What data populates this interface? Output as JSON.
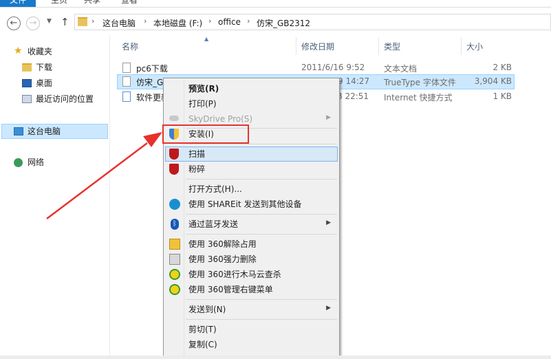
{
  "ribbon": {
    "tabs": [
      "文件",
      "主页",
      "共享",
      "查看"
    ]
  },
  "addressbar": {
    "back_icon": "back-arrow-icon",
    "forward_icon": "forward-arrow-icon",
    "up_icon": "up-arrow-icon",
    "breadcrumb": [
      "这台电脑",
      "本地磁盘 (F:)",
      "office",
      "仿宋_GB2312"
    ]
  },
  "navpane": {
    "items": [
      {
        "label": "收藏夹",
        "icon": "star-icon"
      },
      {
        "label": "下载",
        "icon": "download-folder-icon"
      },
      {
        "label": "桌面",
        "icon": "desktop-icon"
      },
      {
        "label": "最近访问的位置",
        "icon": "recent-places-icon"
      },
      {
        "label": "这台电脑",
        "icon": "computer-icon"
      },
      {
        "label": "网络",
        "icon": "network-icon"
      }
    ]
  },
  "columns": [
    "名称",
    "修改日期",
    "类型",
    "大小"
  ],
  "files": [
    {
      "name": "pc6下载",
      "date": "2011/6/16 9:52",
      "type": "文本文档",
      "size": "2 KB",
      "icon": "text-file-icon"
    },
    {
      "name": "仿宋_GI",
      "date": "9 14:27",
      "type": "TrueType 字体文件",
      "size": "3,904 KB",
      "icon": "font-file-icon"
    },
    {
      "name": "软件更新",
      "date": "8 22:51",
      "type": "Internet 快捷方式",
      "size": "1 KB",
      "icon": "internet-shortcut-icon"
    }
  ],
  "context_menu": {
    "items": [
      {
        "label": "预览(R)",
        "icon": ""
      },
      {
        "label": "打印(P)",
        "icon": ""
      },
      {
        "label": "SkyDrive Pro(S)",
        "icon": "cloud-icon"
      },
      {
        "label": "安装(I)",
        "icon": "uac-shield-icon"
      },
      {
        "label": "扫描",
        "icon": "mcafee-icon"
      },
      {
        "label": "粉碎",
        "icon": "mcafee-icon"
      },
      {
        "label": "打开方式(H)...",
        "icon": ""
      },
      {
        "label": "使用 SHAREit 发送到其他设备",
        "icon": "shareit-icon"
      },
      {
        "label": "通过蓝牙发送",
        "icon": "bluetooth-icon"
      },
      {
        "label": "使用 360解除占用",
        "icon": "360-unlock-icon"
      },
      {
        "label": "使用 360强力删除",
        "icon": "360-shred-icon"
      },
      {
        "label": "使用 360进行木马云查杀",
        "icon": "360-scan-icon"
      },
      {
        "label": "使用 360管理右键菜单",
        "icon": "360-menu-icon"
      },
      {
        "label": "发送到(N)",
        "icon": ""
      },
      {
        "label": "剪切(T)",
        "icon": ""
      },
      {
        "label": "复制(C)",
        "icon": ""
      }
    ]
  },
  "colors": {
    "file_tab": "#1979ca",
    "selection": "#cce8ff",
    "menu_bg": "#f0f0f0",
    "annotation_red": "#e8312c"
  }
}
